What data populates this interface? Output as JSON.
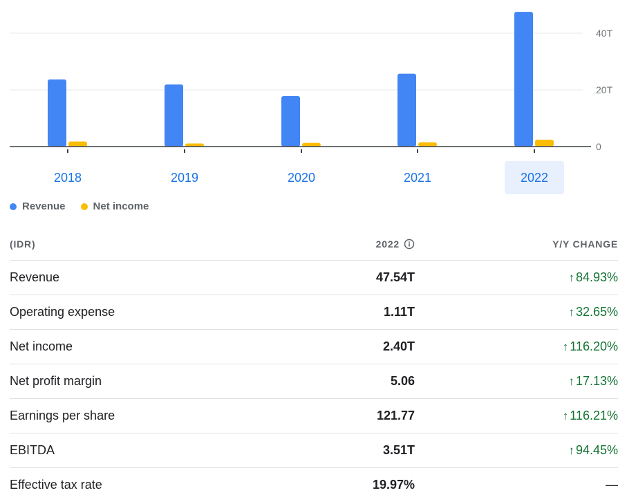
{
  "chart_data": {
    "type": "bar",
    "categories": [
      "2018",
      "2019",
      "2020",
      "2021",
      "2022"
    ],
    "series": [
      {
        "name": "Revenue",
        "color": "#4285f4",
        "values": [
          23.7,
          21.9,
          17.8,
          25.7,
          47.54
        ]
      },
      {
        "name": "Net income",
        "color": "#fbbc04",
        "values": [
          1.8,
          1.1,
          1.3,
          1.5,
          2.4
        ]
      }
    ],
    "y_ticks": [
      {
        "value": 0,
        "label": "0"
      },
      {
        "value": 20,
        "label": "20T"
      },
      {
        "value": 40,
        "label": "40T"
      }
    ],
    "ylim": [
      0,
      50
    ],
    "grid": true,
    "legend_position": "bottom-left",
    "selected_category": "2022"
  },
  "table": {
    "currency_label": "(IDR)",
    "year_label": "2022",
    "change_label": "Y/Y CHANGE",
    "rows": [
      {
        "label": "Revenue",
        "value": "47.54T",
        "change": "84.93%",
        "trend": "up"
      },
      {
        "label": "Operating expense",
        "value": "1.11T",
        "change": "32.65%",
        "trend": "up"
      },
      {
        "label": "Net income",
        "value": "2.40T",
        "change": "116.20%",
        "trend": "up"
      },
      {
        "label": "Net profit margin",
        "value": "5.06",
        "change": "17.13%",
        "trend": "up"
      },
      {
        "label": "Earnings per share",
        "value": "121.77",
        "change": "116.21%",
        "trend": "up"
      },
      {
        "label": "EBITDA",
        "value": "3.51T",
        "change": "94.45%",
        "trend": "up"
      },
      {
        "label": "Effective tax rate",
        "value": "19.97%",
        "change": "—",
        "trend": "none"
      }
    ]
  },
  "colors": {
    "positive": "#137333",
    "accent": "#1a73e8",
    "selected_bg": "#e8f0fe"
  }
}
